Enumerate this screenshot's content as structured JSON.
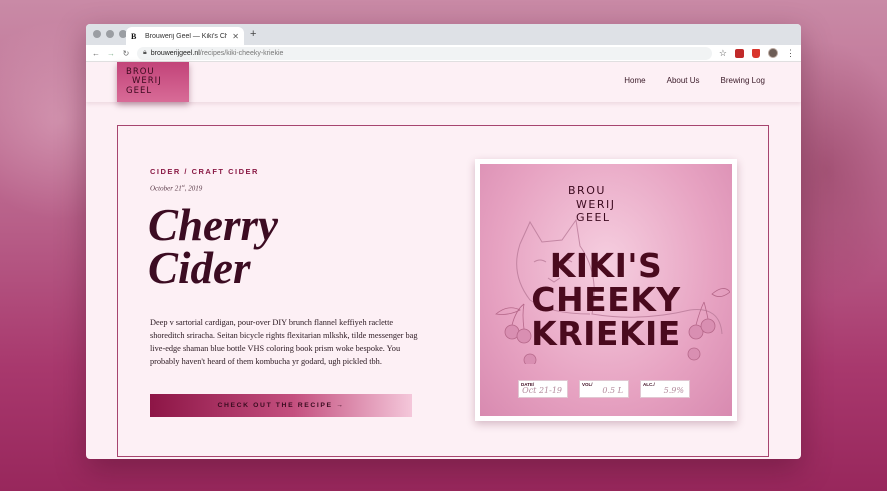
{
  "browser": {
    "tab": {
      "favicon": "B",
      "title": "Brouwerij Geel — Kiki's Cheeky",
      "close_icon": "close-icon"
    },
    "new_tab_label": "+",
    "url": {
      "host": "brouwerijgeel.nl",
      "path": "/recipes/kiki-cheeky-kriekie"
    }
  },
  "site": {
    "logo": [
      "BROU",
      "WERIJ",
      "GEEL"
    ],
    "nav": [
      "Home",
      "About Us",
      "Brewing Log"
    ]
  },
  "post": {
    "category": "CIDER / CRAFT CIDER",
    "date_main": "October 21",
    "date_suffix": "st",
    "date_year": ", 2019",
    "title_line1": "Cherry",
    "title_line2": "Cider",
    "body": "Deep v sartorial cardigan, pour-over DIY brunch flannel keffiyeh raclette shoreditch sriracha. Seitan bicycle rights flexitarian mlkshk, tilde messenger bag live-edge shaman blue bottle VHS coloring book prism woke bespoke. You probably haven't heard of them kombucha yr godard, ugh pickled tbh.",
    "cta": "CHECK OUT THE RECIPE →"
  },
  "label": {
    "logo": [
      "BROU",
      "WERIJ",
      "GEEL"
    ],
    "title": [
      "KIKI'S",
      "CHEEKY",
      "KRIEKIE"
    ],
    "fields": [
      {
        "label": "DATE/",
        "value": "Oct 21-19"
      },
      {
        "label": "VOL/",
        "value": "0.5 L"
      },
      {
        "label": "ALC./",
        "value": "5.9%"
      }
    ]
  },
  "colors": {
    "accent": "#8a1a45",
    "label_pink": "#e7a3c2",
    "label_text": "#4a0a1e"
  }
}
